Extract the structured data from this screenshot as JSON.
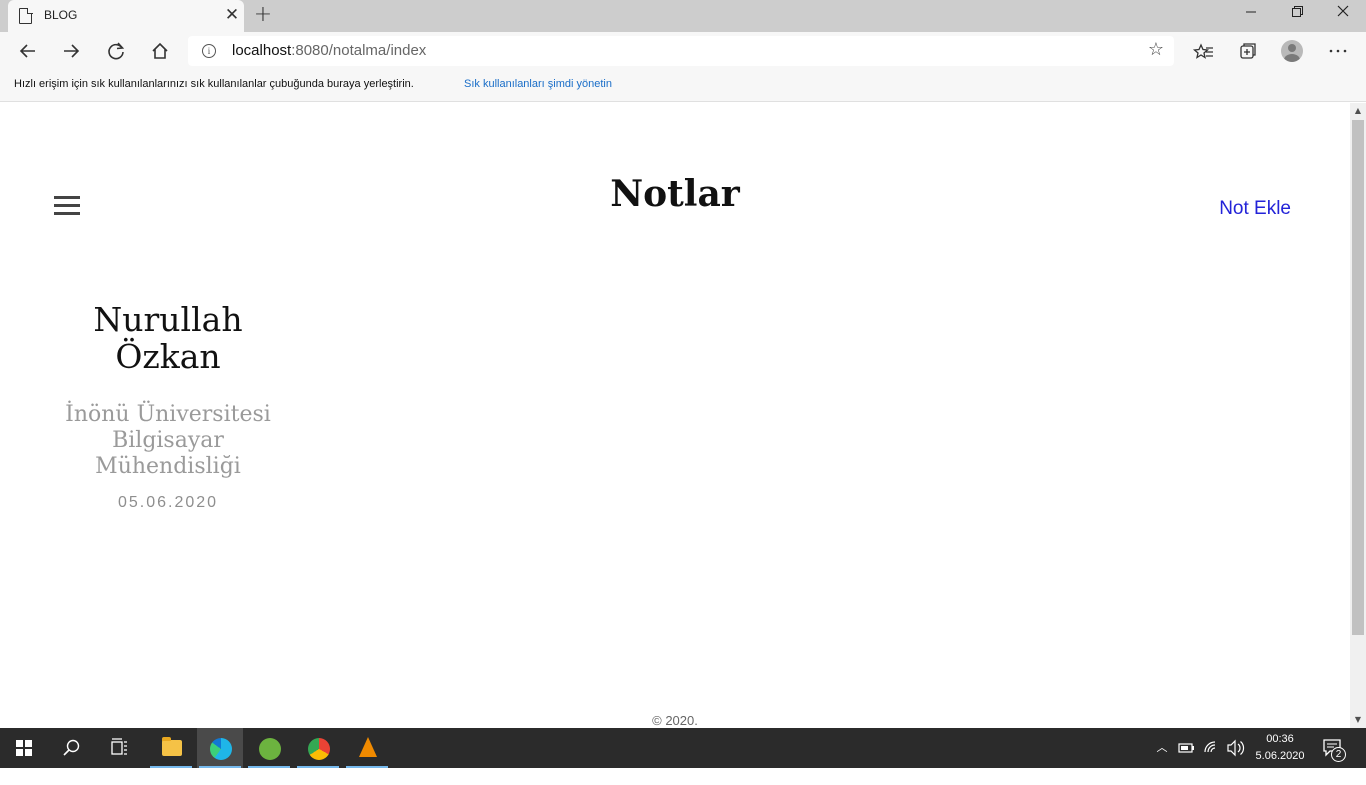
{
  "browser": {
    "tab_title": "BLOG",
    "tab_close": "✕",
    "new_tab": "+",
    "url_host": "localhost",
    "url_rest": ":8080/notalma/index",
    "favorites_prompt": "Hızlı erişim için sık kullanılanlarınızı sık kullanılanlar çubuğunda buraya yerleştirin.",
    "favorites_link": "Sık kullanılanları şimdi yönetin",
    "icons": [
      "page-icon",
      "back-icon",
      "forward-icon",
      "refresh-icon",
      "home-icon",
      "info-icon",
      "star-icon",
      "favorites-icon",
      "collections-icon",
      "profile-icon",
      "more-icon"
    ]
  },
  "page": {
    "title": "Notlar",
    "add_note": "Not Ekle",
    "author_name": "Nurullah Özkan",
    "university": "İnönü Üniversitesi Bilgisayar Mühendisliği",
    "date": "05.06.2020",
    "footer": "© 2020."
  },
  "taskbar": {
    "apps": [
      "windows-start",
      "search",
      "task-view",
      "file-explorer",
      "edge",
      "spring-tool-suite",
      "chrome",
      "vlc"
    ],
    "clock_time": "00:36",
    "clock_date": "5.06.2020",
    "notification_count": "2"
  },
  "colors": {
    "add_note_link": "#2323d8",
    "favorites_link": "#1a6ec8",
    "taskbar": "#2b2b2b"
  }
}
